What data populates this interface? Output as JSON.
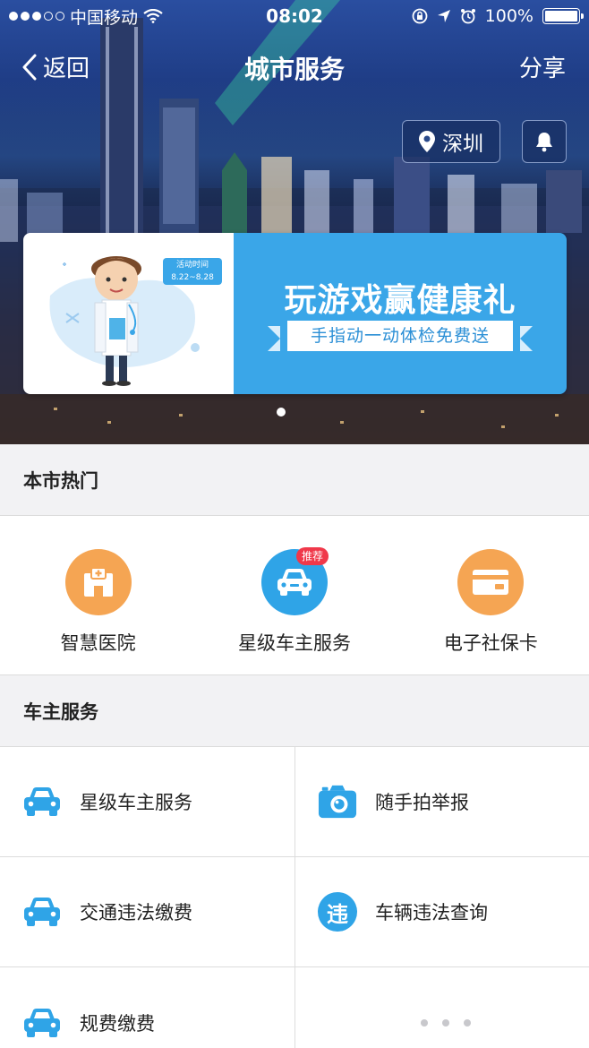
{
  "status_bar": {
    "carrier": "中国移动",
    "time": "08:02",
    "battery": "100%"
  },
  "nav": {
    "back_label": "返回",
    "title": "城市服务",
    "share_label": "分享"
  },
  "location": {
    "city": "深圳"
  },
  "banner": {
    "title": "玩游戏赢健康礼",
    "subtitle": "手指动一动体检免费送",
    "tag_title": "活动时间",
    "tag_dates": "8.22~8.28"
  },
  "hot_section": {
    "title": "本市热门",
    "items": [
      {
        "label": "智慧医院",
        "icon": "hospital-icon",
        "color": "#f5a553"
      },
      {
        "label": "星级车主服务",
        "icon": "car-icon",
        "color": "#2fa4e7",
        "badge": "推荐"
      },
      {
        "label": "电子社保卡",
        "icon": "card-icon",
        "color": "#f5a553"
      }
    ]
  },
  "car_section": {
    "title": "车主服务",
    "items": [
      {
        "label": "星级车主服务",
        "icon": "car-icon"
      },
      {
        "label": "随手拍举报",
        "icon": "camera-icon"
      },
      {
        "label": "交通违法缴费",
        "icon": "car-icon"
      },
      {
        "label": "车辆违法查询",
        "icon": "violation-icon",
        "glyph": "违"
      },
      {
        "label": "规费缴费",
        "icon": "car-icon"
      }
    ]
  },
  "colors": {
    "accent_blue": "#2fa4e7",
    "accent_orange": "#f5a553",
    "badge_red": "#f0384a"
  }
}
